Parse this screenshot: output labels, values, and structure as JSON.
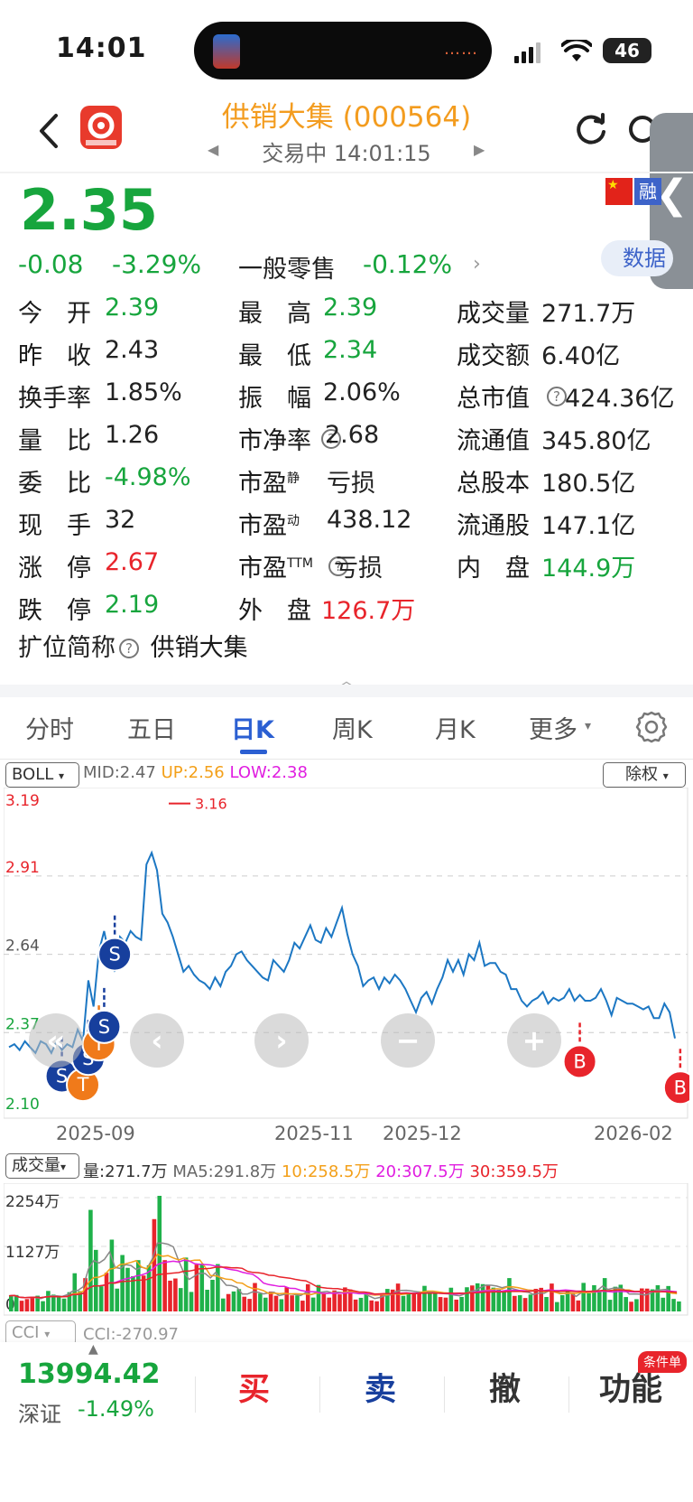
{
  "status": {
    "time": "14:01",
    "battery": "46",
    "island_dots": "……"
  },
  "header": {
    "title": "供销大集 (000564)",
    "trade_status": "交易中 14:01:15"
  },
  "quote": {
    "price": "2.35",
    "change": "-0.08",
    "change_pct": "-3.29%",
    "industry": "一般零售",
    "industry_change": "-0.12%",
    "data_button": "数据",
    "flag_label": "融"
  },
  "stats": {
    "col1": [
      {
        "label": "今　开",
        "value": "2.39",
        "color": "g"
      },
      {
        "label": "昨　收",
        "value": "2.43",
        "color": "k"
      },
      {
        "label": "换手率",
        "value": "1.85%",
        "color": "k"
      },
      {
        "label": "量　比",
        "value": "1.26",
        "color": "k"
      },
      {
        "label": "委　比",
        "value": "-4.98%",
        "color": "g"
      },
      {
        "label": "现　手",
        "value": "32",
        "color": "k"
      },
      {
        "label": "涨　停",
        "value": "2.67",
        "color": "r"
      },
      {
        "label": "跌　停",
        "value": "2.19",
        "color": "g"
      }
    ],
    "col2": [
      {
        "label": "最　高",
        "value": "2.39",
        "color": "g"
      },
      {
        "label": "最　低",
        "value": "2.34",
        "color": "g"
      },
      {
        "label": "振　幅",
        "value": "2.06%",
        "color": "k"
      },
      {
        "label": "市净率",
        "value": "2.68",
        "color": "k"
      },
      {
        "label": "市盈",
        "value": "亏损",
        "color": "k",
        "sup": "静"
      },
      {
        "label": "市盈",
        "value": "438.12",
        "color": "k",
        "sup": "动"
      },
      {
        "label": "市盈",
        "value": "亏损",
        "color": "k",
        "sup": "TTM"
      },
      {
        "label": "外　盘",
        "value": "126.7万",
        "color": "r"
      }
    ],
    "col3": [
      {
        "label": "成交量",
        "value": "271.7万",
        "color": "k"
      },
      {
        "label": "成交额",
        "value": "6.40亿",
        "color": "k"
      },
      {
        "label": "总市值",
        "value": "424.36亿",
        "color": "k"
      },
      {
        "label": "流通值",
        "value": "345.80亿",
        "color": "k"
      },
      {
        "label": "总股本",
        "value": "180.5亿",
        "color": "k"
      },
      {
        "label": "流通股",
        "value": "147.1亿",
        "color": "k"
      },
      {
        "label": "内　盘",
        "value": "144.9万",
        "color": "g"
      }
    ],
    "ext_label": "扩位简称",
    "ext_value": "供销大集"
  },
  "tabs": [
    "分时",
    "五日",
    "日K",
    "周K",
    "月K",
    "更多"
  ],
  "chart": {
    "indicator_select": "BOLL",
    "boll_mid": "MID:2.47",
    "boll_up": "UP:2.56",
    "boll_low": "LOW:2.38",
    "adjust_select": "除权",
    "max_marker": "3.16",
    "vol_select": "成交量",
    "vol_value": "量:271.7万",
    "ma5": "MA5:291.8万",
    "ma10": "10:258.5万",
    "ma20": "20:307.5万",
    "ma30": "30:359.5万",
    "cci_select": "CCI",
    "cci_value": "CCI:-270.97"
  },
  "chart_data": {
    "type": "line",
    "title": "",
    "ylim": [
      2.1,
      3.19
    ],
    "y_ticks": [
      "3.19",
      "2.91",
      "2.64",
      "2.37",
      "2.10"
    ],
    "x_ticks": [
      "2025-09",
      "2025-11",
      "2025-12",
      "2026-02"
    ],
    "grid": true,
    "series": [
      {
        "values": [
          2.32,
          2.33,
          2.31,
          2.34,
          2.32,
          2.3,
          2.34,
          2.33,
          2.3,
          2.34,
          2.31,
          2.33,
          2.32,
          2.38,
          2.34,
          2.55,
          2.46,
          2.65,
          2.72,
          2.63,
          2.58,
          2.7,
          2.68,
          2.72,
          2.7,
          2.69,
          2.95,
          2.99,
          2.93,
          2.78,
          2.75,
          2.7,
          2.64,
          2.58,
          2.6,
          2.57,
          2.55,
          2.54,
          2.52,
          2.56,
          2.53,
          2.58,
          2.6,
          2.64,
          2.65,
          2.62,
          2.6,
          2.58,
          2.56,
          2.55,
          2.62,
          2.6,
          2.58,
          2.62,
          2.68,
          2.66,
          2.7,
          2.74,
          2.69,
          2.68,
          2.73,
          2.7,
          2.75,
          2.8,
          2.71,
          2.64,
          2.6,
          2.53,
          2.55,
          2.56,
          2.52,
          2.56,
          2.54,
          2.57,
          2.55,
          2.52,
          2.48,
          2.44,
          2.49,
          2.51,
          2.47,
          2.52,
          2.56,
          2.62,
          2.58,
          2.62,
          2.57,
          2.64,
          2.62,
          2.68,
          2.6,
          2.61,
          2.61,
          2.58,
          2.57,
          2.52,
          2.52,
          2.48,
          2.46,
          2.48,
          2.49,
          2.51,
          2.47,
          2.49,
          2.48,
          2.49,
          2.52,
          2.48,
          2.5,
          2.48,
          2.48,
          2.49,
          2.52,
          2.48,
          2.43,
          2.49,
          2.48,
          2.47,
          2.47,
          2.46,
          2.45,
          2.46,
          2.42,
          2.42,
          2.47,
          2.44,
          2.35
        ]
      }
    ],
    "signals": [
      {
        "label": "S",
        "color": "#173f9d",
        "index": 20,
        "price": 2.64
      },
      {
        "label": "S",
        "color": "#173f9d",
        "index": 10,
        "price": 2.22
      },
      {
        "label": "T",
        "color": "#f07a1a",
        "index": 14,
        "price": 2.19
      },
      {
        "label": "S",
        "color": "#173f9d",
        "index": 15,
        "price": 2.28
      },
      {
        "label": "T",
        "color": "#f07a1a",
        "index": 17,
        "price": 2.33
      },
      {
        "label": "S",
        "color": "#173f9d",
        "index": 18,
        "price": 2.39
      },
      {
        "label": "B",
        "color": "#e8242b",
        "index": 108,
        "price": 2.27
      },
      {
        "label": "B",
        "color": "#e8242b",
        "index": 127,
        "price": 2.18
      }
    ],
    "volume": {
      "ylabels": [
        "2254万",
        "1127万",
        "0"
      ],
      "ylim": [
        0,
        2254
      ]
    }
  },
  "controls": {
    "prev": "‹",
    "next": "›",
    "minus": "−",
    "plus": "+",
    "first": "«"
  },
  "bottom": {
    "index_value": "13994.42",
    "index_name": "深证",
    "index_change": "-1.49%",
    "buy": "买",
    "sell": "卖",
    "cancel": "撤",
    "func": "功能",
    "badge": "条件单"
  }
}
